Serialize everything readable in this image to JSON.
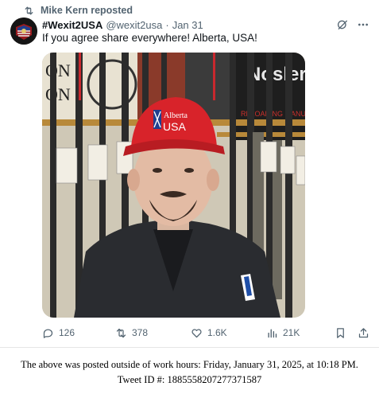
{
  "repost": {
    "label": "Mike Kern reposted",
    "icon": "repost-icon"
  },
  "author": {
    "display_name": "#Wexit2USA",
    "handle": "@wexit2usa",
    "separator": "·",
    "time": "Jan 31"
  },
  "tweet": {
    "text": "If you agree share everywhere! Alberta, USA!"
  },
  "media": {
    "hat_line1": "Alberta",
    "hat_line2": "USA",
    "description_colors": {
      "hat": "#d8232a",
      "jacket": "#2a2c30"
    }
  },
  "actions": {
    "replies": "126",
    "reposts": "378",
    "likes": "1.6K",
    "views": "21K"
  },
  "footer": {
    "line1": "The above was posted outside of work hours: Friday, January 31, 2025, at 10:18 PM.",
    "line2": "Tweet ID #: 1885558207277371587"
  },
  "colors": {
    "muted": "#536471",
    "text": "#0f1419"
  }
}
